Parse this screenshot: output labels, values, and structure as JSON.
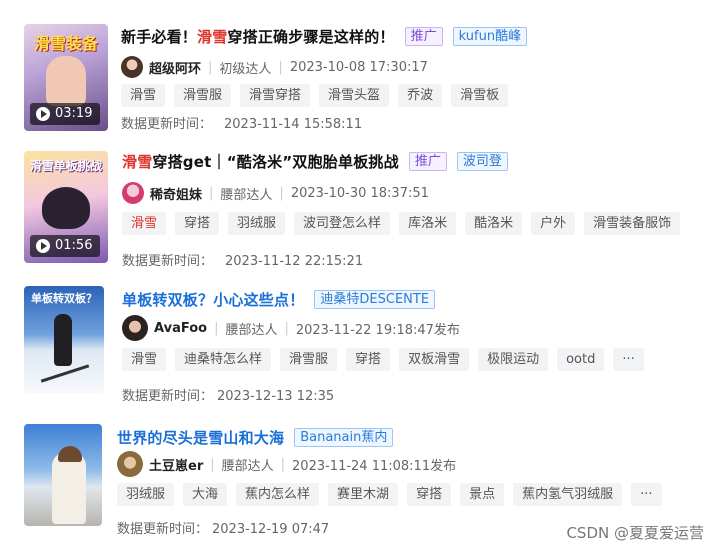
{
  "updated_label": "数据更新时间：",
  "more_symbol": "···",
  "items": [
    {
      "title_hl": "",
      "title_pre": "新手必看！",
      "title_hl2": "滑雪",
      "title_post": "穿搭正确步骤是这样的！",
      "badges": [
        "推广",
        "kufun酷峰"
      ],
      "author": "超级阿环",
      "level": "初级达人",
      "date": "2023-10-08 17:30:17",
      "tags": [
        "滑雪",
        "滑雪服",
        "滑雪穿搭",
        "滑雪头盔",
        "乔波",
        "滑雪板"
      ],
      "updated": "2023-11-14 15:58:11",
      "duration": "03:19",
      "cover_text": "滑雪装备"
    },
    {
      "title_hl": "滑雪",
      "title_post": "穿搭get｜“酷洛米”双胞胎单板挑战",
      "badges": [
        "推广",
        "波司登"
      ],
      "author": "稀奇姐妹",
      "level": "腰部达人",
      "date": "2023-10-30 18:37:51",
      "tags": [
        "滑雪",
        "穿搭",
        "羽绒服",
        "波司登怎么样",
        "库洛米",
        "酷洛米",
        "户外",
        "滑雪装备服饰"
      ],
      "updated": "2023-11-12 22:15:21",
      "duration": "01:56",
      "cover_text": "滑雪单板挑战"
    },
    {
      "title": "单板转双板？小心这些点！",
      "badges": [
        "迪桑特DESCENTE"
      ],
      "author": "AvaFoo",
      "level": "腰部达人",
      "date": "2023-11-22 19:18:47发布",
      "tags": [
        "滑雪",
        "迪桑特怎么样",
        "滑雪服",
        "穿搭",
        "双板滑雪",
        "极限运动",
        "ootd"
      ],
      "updated": "2023-12-13 12:35",
      "cover_text": "单板转双板？"
    },
    {
      "title": "世界的尽头是雪山和大海",
      "badges": [
        "Bananain蕉内"
      ],
      "author": "土豆崽er",
      "level": "腰部达人",
      "date": "2023-11-24 11:08:11发布",
      "tags": [
        "羽绒服",
        "大海",
        "蕉内怎么样",
        "赛里木湖",
        "穿搭",
        "景点",
        "蕉内氢气羽绒服"
      ],
      "updated": "2023-12-19 07:47"
    }
  ],
  "watermark": "CSDN @夏夏爱运营"
}
